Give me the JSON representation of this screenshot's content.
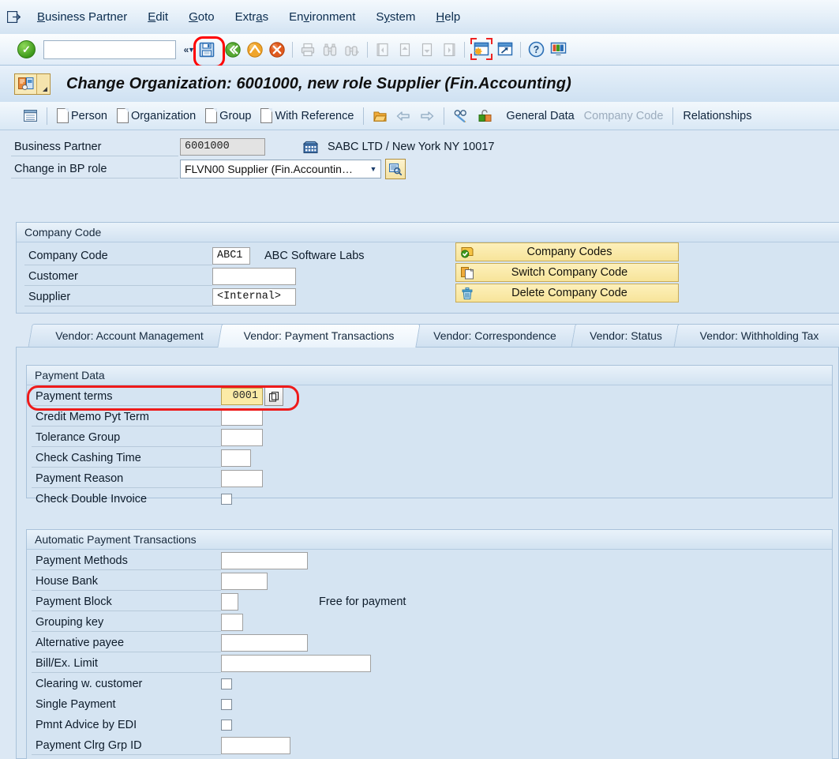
{
  "menubar": {
    "system_icon": "system-menu-icon",
    "items": [
      {
        "label": "Business Partner",
        "accesskey": "B"
      },
      {
        "label": "Edit",
        "accesskey": "E"
      },
      {
        "label": "Goto",
        "accesskey": "G"
      },
      {
        "label": "Extras",
        "accesskey": "a"
      },
      {
        "label": "Environment",
        "accesskey": "v"
      },
      {
        "label": "System",
        "accesskey": "y"
      },
      {
        "label": "Help",
        "accesskey": "H"
      }
    ]
  },
  "toolbar": {
    "enter_icon": "green-check-enter-icon",
    "command_field_value": "",
    "command_field_placeholder": "",
    "buttons": [
      {
        "name": "save-button",
        "icon": "save-disk-icon",
        "enabled": true,
        "highlighted": true
      },
      {
        "name": "back-button",
        "icon": "green-back-arrow-icon",
        "enabled": true
      },
      {
        "name": "exit-button",
        "icon": "yellow-exit-up-arrow-icon",
        "enabled": true
      },
      {
        "name": "cancel-button",
        "icon": "red-cancel-x-icon",
        "enabled": true
      },
      {
        "name": "print-button",
        "icon": "printer-icon",
        "enabled": false
      },
      {
        "name": "find-button",
        "icon": "binoculars-icon",
        "enabled": false
      },
      {
        "name": "find-next-button",
        "icon": "binoculars-plus-icon",
        "enabled": false
      },
      {
        "name": "first-page-button",
        "icon": "first-page-icon",
        "enabled": false
      },
      {
        "name": "previous-page-button",
        "icon": "previous-page-icon",
        "enabled": false
      },
      {
        "name": "next-page-button",
        "icon": "next-page-icon",
        "enabled": false
      },
      {
        "name": "last-page-button",
        "icon": "last-page-icon",
        "enabled": false
      },
      {
        "name": "create-session-button",
        "icon": "new-session-window-icon",
        "enabled": true,
        "highlighted": true
      },
      {
        "name": "create-shortcut-button",
        "icon": "shortcut-window-icon",
        "enabled": true
      },
      {
        "name": "help-button",
        "icon": "question-mark-help-icon",
        "enabled": true
      },
      {
        "name": "customize-layout-button",
        "icon": "layout-monitor-icon",
        "enabled": true
      }
    ]
  },
  "title": {
    "icon": "business-partner-title-icon",
    "text": "Change Organization: 6001000, new role Supplier (Fin.Accounting)"
  },
  "app_toolbar": {
    "items": [
      {
        "name": "list-display-button",
        "label": "",
        "icon": "list-table-icon",
        "enabled": true
      },
      {
        "name": "person-button",
        "label": "Person",
        "icon": "page-icon",
        "enabled": true
      },
      {
        "name": "organization-button",
        "label": "Organization",
        "icon": "page-icon",
        "enabled": true
      },
      {
        "name": "group-button",
        "label": "Group",
        "icon": "page-icon",
        "enabled": true
      },
      {
        "name": "with-reference-button",
        "label": "With Reference",
        "icon": "page-icon",
        "enabled": true
      },
      {
        "name": "open-folder-button",
        "label": "",
        "icon": "open-folder-icon",
        "enabled": true
      },
      {
        "name": "back-arrow-button",
        "label": "",
        "icon": "left-arrow-icon",
        "enabled": false
      },
      {
        "name": "forward-arrow-button",
        "label": "",
        "icon": "right-arrow-icon",
        "enabled": false
      },
      {
        "name": "display-change-button",
        "label": "",
        "icon": "glasses-pencil-icon",
        "enabled": true
      },
      {
        "name": "lock-button",
        "label": "",
        "icon": "open-lock-icon",
        "enabled": true
      },
      {
        "name": "general-data-button",
        "label": "General Data",
        "icon": "",
        "enabled": true
      },
      {
        "name": "company-code-button",
        "label": "Company Code",
        "icon": "",
        "enabled": false
      },
      {
        "name": "relationships-button",
        "label": "Relationships",
        "icon": "",
        "enabled": true
      }
    ]
  },
  "header": {
    "business_partner_label": "Business Partner",
    "business_partner_value": "6001000",
    "partner_icon": "organization-building-icon",
    "partner_description": "SABC LTD / New York NY 10017",
    "bp_role_label": "Change in BP role",
    "bp_role_value": "FLVN00 Supplier (Fin.Accountin…",
    "bp_role_search_icon": "search-magnifier-icon"
  },
  "company_code_group": {
    "title": "Company Code",
    "fields": [
      {
        "label": "Company Code",
        "value": "ABC1",
        "description": "ABC Software Labs"
      },
      {
        "label": "Customer",
        "value": "",
        "description": ""
      },
      {
        "label": "Supplier",
        "value": "<Internal>",
        "description": ""
      }
    ],
    "buttons": [
      {
        "label": "Company Codes",
        "icon": "company-codes-check-icon"
      },
      {
        "label": "Switch Company Code",
        "icon": "switch-copy-icon"
      },
      {
        "label": "Delete Company Code",
        "icon": "trash-delete-icon"
      }
    ]
  },
  "tabs": {
    "selected_index": 1,
    "items": [
      {
        "label": "Vendor: Account Management"
      },
      {
        "label": "Vendor: Payment Transactions"
      },
      {
        "label": "Vendor: Correspondence"
      },
      {
        "label": "Vendor: Status"
      },
      {
        "label": "Vendor: Withholding Tax"
      }
    ]
  },
  "payment_data_group": {
    "title": "Payment Data",
    "fields": [
      {
        "label": "Payment terms",
        "value": "0001",
        "type": "input",
        "highlighted": true,
        "has_lookup": true
      },
      {
        "label": "Credit Memo Pyt Term",
        "value": "",
        "type": "input"
      },
      {
        "label": "Tolerance Group",
        "value": "",
        "type": "input"
      },
      {
        "label": "Check Cashing Time",
        "value": "",
        "type": "input"
      },
      {
        "label": "Payment Reason",
        "value": "",
        "type": "input"
      },
      {
        "label": "Check Double Invoice",
        "value": "",
        "type": "checkbox",
        "checked": false
      }
    ]
  },
  "automatic_payment_group": {
    "title": "Automatic Payment Transactions",
    "fields": [
      {
        "label": "Payment Methods",
        "value": "",
        "type": "input"
      },
      {
        "label": "House Bank",
        "value": "",
        "type": "input"
      },
      {
        "label": "Payment Block",
        "value": "",
        "type": "input",
        "description": "Free for payment"
      },
      {
        "label": "Grouping key",
        "value": "",
        "type": "input"
      },
      {
        "label": "Alternative payee",
        "value": "",
        "type": "input"
      },
      {
        "label": "Bill/Ex. Limit",
        "value": "",
        "type": "input"
      },
      {
        "label": "Clearing w. customer",
        "value": "",
        "type": "checkbox",
        "checked": false
      },
      {
        "label": "Single Payment",
        "value": "",
        "type": "checkbox",
        "checked": false
      },
      {
        "label": "Pmnt Advice by EDI",
        "value": "",
        "type": "checkbox",
        "checked": false
      },
      {
        "label": "Payment Clrg Grp ID",
        "value": "",
        "type": "input"
      }
    ]
  },
  "colors": {
    "background": "#dce8f4",
    "panel": "#d8e6f3",
    "highlight_ring": "#ee1b1b",
    "required_field": "#fbeaa6",
    "button_yellow": "#f7e49a"
  }
}
